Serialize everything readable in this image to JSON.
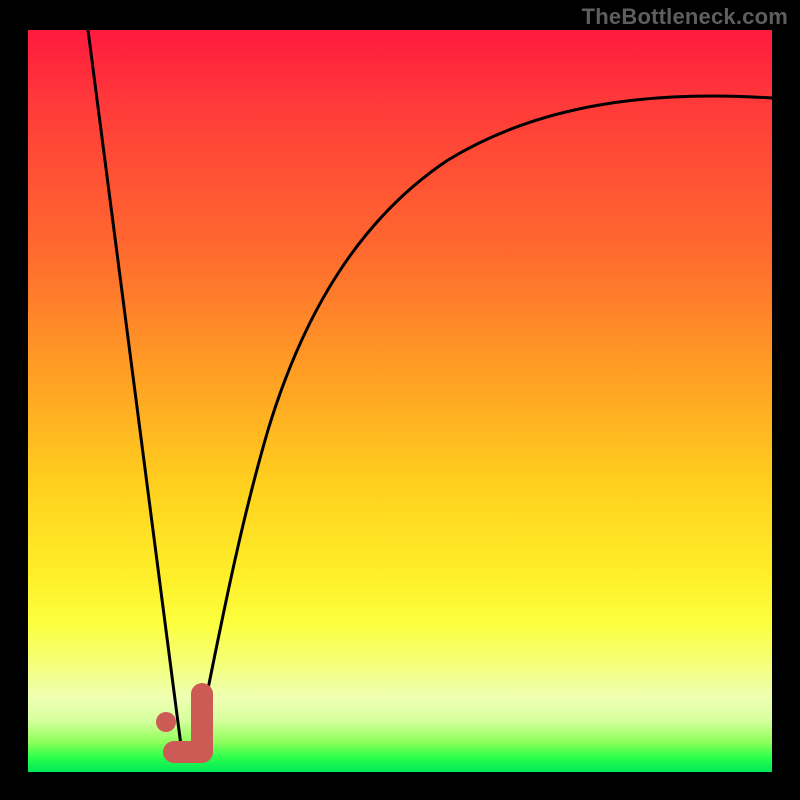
{
  "attribution": "TheBottleneck.com",
  "colors": {
    "curve": "#000000",
    "marker": "#cc5b55",
    "gradient_top": "#ff1a3e",
    "gradient_bottom": "#00e858"
  },
  "chart_data": {
    "type": "line",
    "title": "",
    "xlabel": "",
    "ylabel": "",
    "xlim": [
      0,
      100
    ],
    "ylim": [
      0,
      100
    ],
    "grid": false,
    "legend": false,
    "note": "Axes have no tick labels; values are estimated in percent of plot width/height. Higher y = farther from top (since visual origin is top-left).",
    "series": [
      {
        "name": "left-descending-line",
        "x": [
          8.0,
          20.8
        ],
        "y": [
          100.0,
          1.5
        ]
      },
      {
        "name": "right-rising-curve",
        "x": [
          22.2,
          25.0,
          28.0,
          32.0,
          36.0,
          41.0,
          47.0,
          55.0,
          65.0,
          78.0,
          90.0,
          100.0
        ],
        "y": [
          1.5,
          14.0,
          27.0,
          42.0,
          54.0,
          64.0,
          72.5,
          79.0,
          84.0,
          87.5,
          89.5,
          90.8
        ]
      }
    ],
    "annotations": [
      {
        "name": "marker-j-glyph",
        "shape": "J-like tick with dot",
        "approx_center_xy_percent": [
          21.5,
          5.0
        ]
      }
    ]
  }
}
